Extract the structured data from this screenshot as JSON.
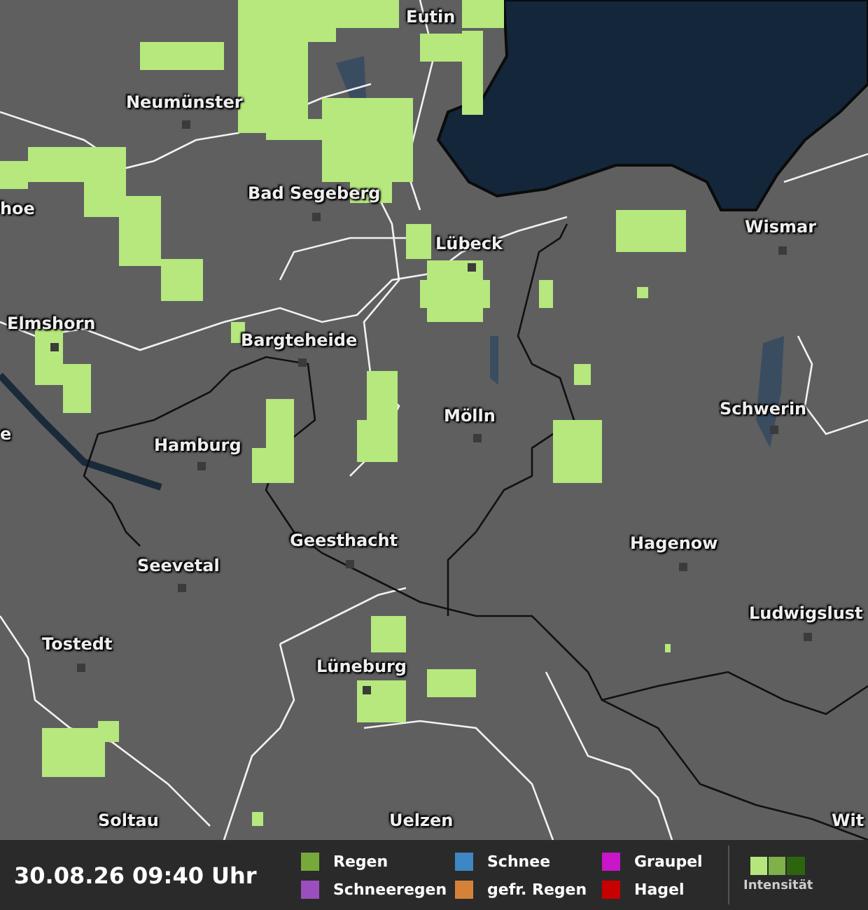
{
  "map": {
    "places": [
      {
        "name": "Eutin"
      },
      {
        "name": "Neumünster"
      },
      {
        "name": "Bad Segeberg"
      },
      {
        "name": "hoe"
      },
      {
        "name": "Lübeck"
      },
      {
        "name": "Wismar"
      },
      {
        "name": "Elmshorn"
      },
      {
        "name": "Bargteheide"
      },
      {
        "name": "Mölln"
      },
      {
        "name": "Schwerin"
      },
      {
        "name": "e"
      },
      {
        "name": "Hamburg"
      },
      {
        "name": "Geesthacht"
      },
      {
        "name": "Seevetal"
      },
      {
        "name": "Hagenow"
      },
      {
        "name": "Ludwigslust"
      },
      {
        "name": "Tostedt"
      },
      {
        "name": "Lüneburg"
      },
      {
        "name": "Soltau"
      },
      {
        "name": "Uelzen"
      },
      {
        "name": "Wit"
      }
    ]
  },
  "bottom_bar": {
    "timestamp": "30.08.26 09:40 Uhr",
    "legend": [
      {
        "label": "Regen",
        "color": "#77a83c"
      },
      {
        "label": "Schnee",
        "color": "#3f86c4"
      },
      {
        "label": "Graupel",
        "color": "#c816c8"
      },
      {
        "label": "Schneeregen",
        "color": "#9b4fbe"
      },
      {
        "label": "gefr. Regen",
        "color": "#d4823a"
      },
      {
        "label": "Hagel",
        "color": "#c80000"
      }
    ],
    "intensity_label": "Intensität"
  }
}
